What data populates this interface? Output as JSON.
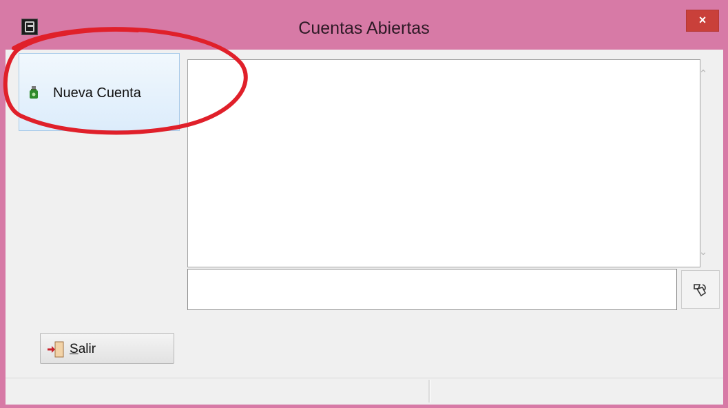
{
  "window": {
    "title": "Cuentas Abiertas",
    "close_symbol": "×",
    "app_icon": "app-logo-icon",
    "accent_color": "#d77aa6",
    "close_color": "#c9403a"
  },
  "sidebar": {
    "new_account_label": "Nueva Cuenta",
    "new_account_icon": "green-money-bag-icon"
  },
  "list": {
    "items": [],
    "scroll_up_symbol": "⌃",
    "scroll_down_symbol": "⌄"
  },
  "search": {
    "value": "",
    "button_icon": "keyboard-input-icon"
  },
  "footer": {
    "exit_label_mnemonic": "S",
    "exit_label_rest": "alir",
    "exit_icon": "exit-door-icon"
  },
  "annotation": {
    "shape": "ellipse",
    "color": "#e0202a"
  }
}
